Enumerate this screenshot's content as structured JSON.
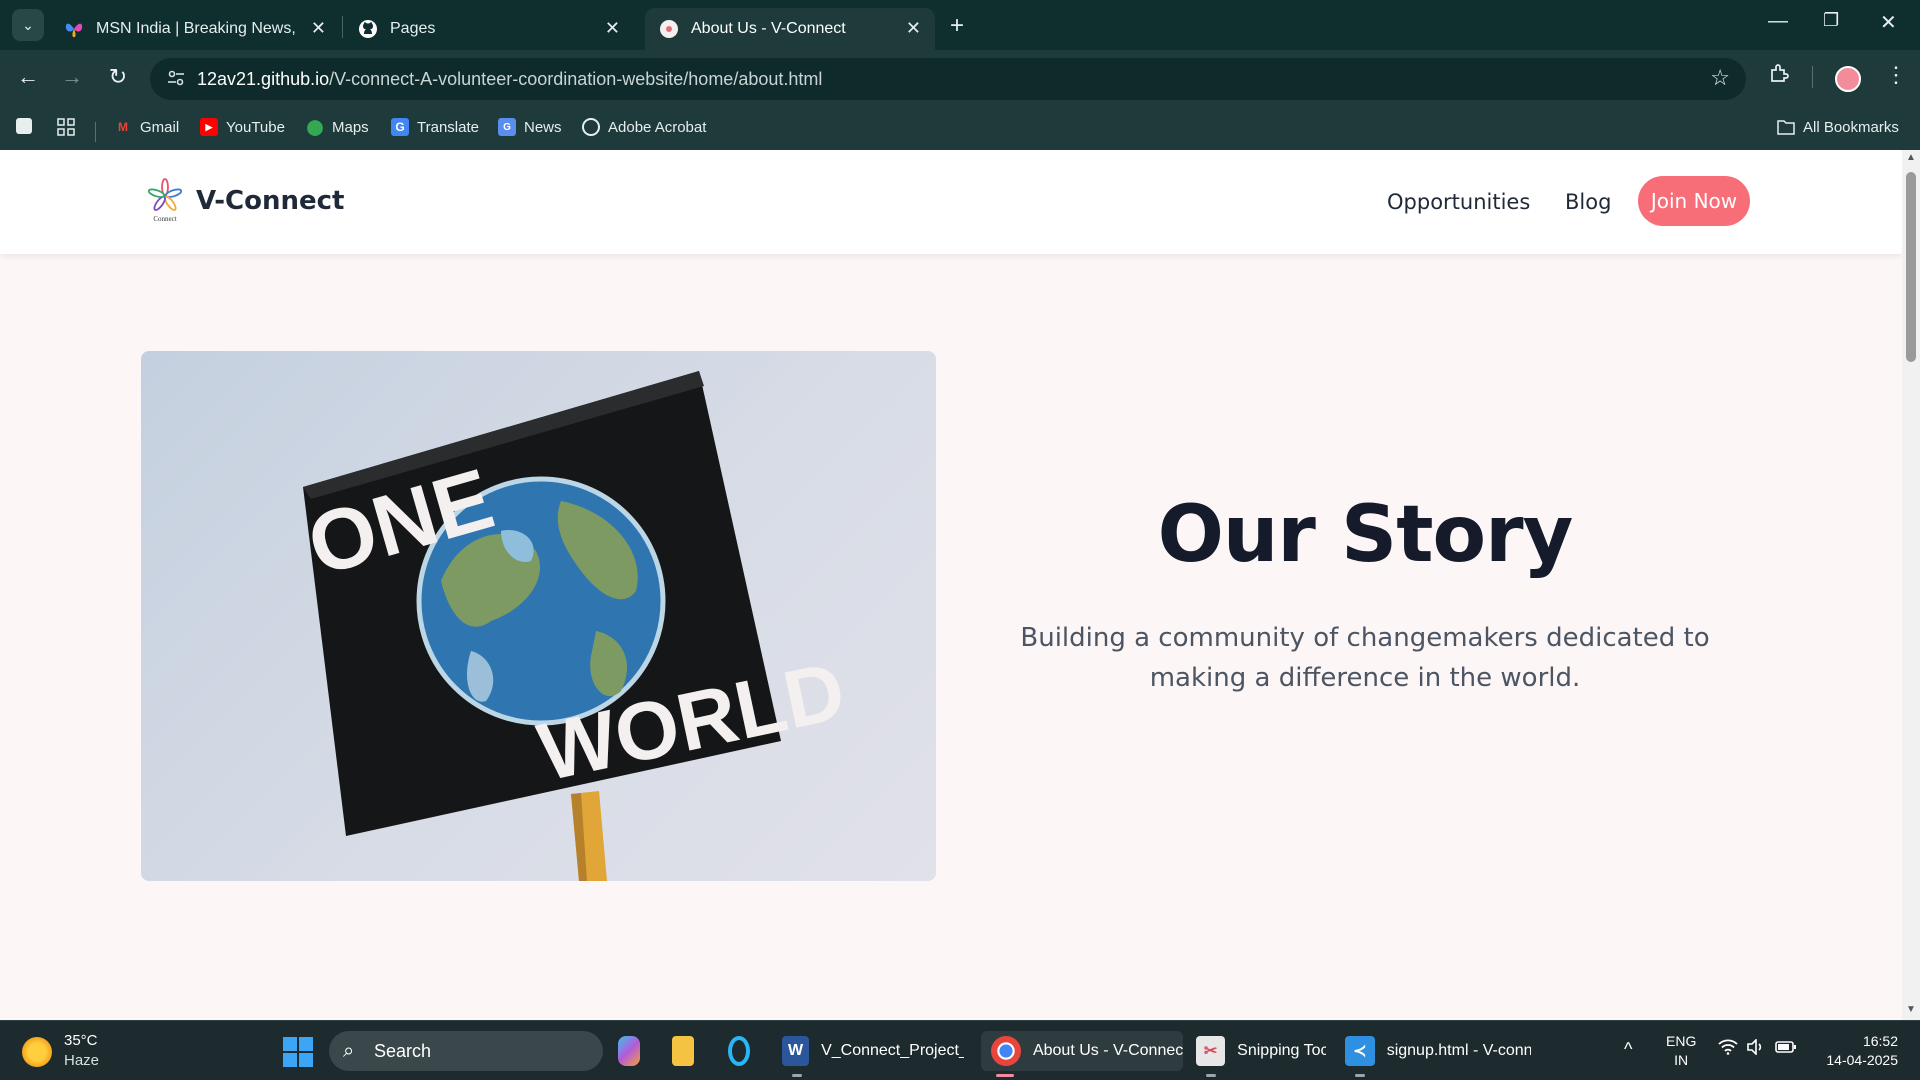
{
  "browser": {
    "tabs": [
      {
        "title": "MSN India | Breaking News, Ent"
      },
      {
        "title": "Pages"
      },
      {
        "title": "About Us - V-Connect"
      }
    ],
    "url_host": "12av21.github.io",
    "url_path": "/V-connect-A-volunteer-coordination-website/home/about.html",
    "bookmarks": [
      "Gmail",
      "YouTube",
      "Maps",
      "Translate",
      "News",
      "Adobe Acrobat"
    ],
    "all_bookmarks": "All Bookmarks"
  },
  "site": {
    "logo_caption": "Connect",
    "brand": "V-Connect",
    "nav": {
      "opportunities": "Opportunities",
      "blog": "Blog",
      "join": "Join Now"
    },
    "hero_image": {
      "sign_top": "ONE",
      "sign_bottom": "WORLD"
    },
    "story": {
      "title": "Our Story",
      "subtitle": "Building a community of changemakers dedicated to making a difference in the world."
    }
  },
  "taskbar": {
    "weather": {
      "temp": "35°C",
      "desc": "Haze"
    },
    "search": "Search",
    "apps": [
      {
        "label": "V_Connect_Project_R",
        "color": "#2b579a"
      },
      {
        "label": "About Us - V-Connec",
        "color": "#e8453c"
      },
      {
        "label": "Snipping Toc",
        "color": "#d84a5a"
      },
      {
        "label": "signup.html - V-conn",
        "color": "#2f8fe0"
      }
    ],
    "lang": {
      "line1": "ENG",
      "line2": "IN"
    },
    "clock": {
      "time": "16:52",
      "date": "14-04-2025"
    }
  },
  "colors": {
    "accent": "#f76d78",
    "page_bg": "#fdf6f6",
    "title": "#151b2b",
    "chrome_dark": "#0f2e2e",
    "chrome": "#1f3a3a"
  }
}
